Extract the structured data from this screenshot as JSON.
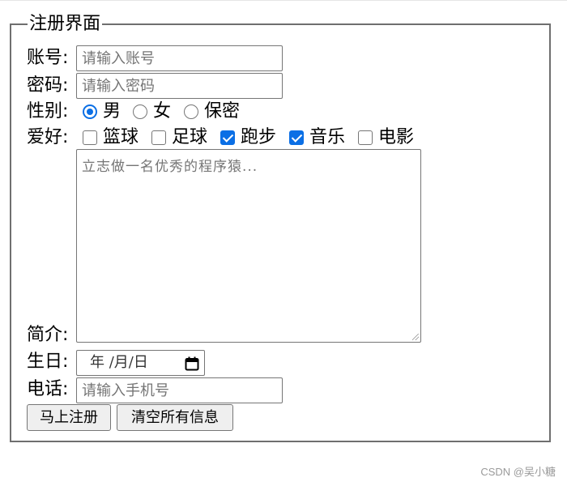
{
  "form": {
    "legend": "注册界面",
    "account": {
      "label": "账号:",
      "placeholder": "请输入账号",
      "value": ""
    },
    "password": {
      "label": "密码:",
      "placeholder": "请输入密码",
      "value": ""
    },
    "gender": {
      "label": "性别:",
      "options": [
        {
          "label": "男",
          "checked": true
        },
        {
          "label": "女",
          "checked": false
        },
        {
          "label": "保密",
          "checked": false
        }
      ]
    },
    "hobbies": {
      "label": "爱好:",
      "options": [
        {
          "label": "篮球",
          "checked": false
        },
        {
          "label": "足球",
          "checked": false
        },
        {
          "label": "跑步",
          "checked": true
        },
        {
          "label": "音乐",
          "checked": true
        },
        {
          "label": "电影",
          "checked": false
        }
      ]
    },
    "intro": {
      "label": "简介:",
      "placeholder": "立志做一名优秀的程序猿..."
    },
    "birthday": {
      "label": "生日:",
      "display": "年 /月/日",
      "icon": "calendar-icon"
    },
    "phone": {
      "label": "电话:",
      "placeholder": "请输入手机号",
      "value": ""
    },
    "buttons": {
      "submit": "马上注册",
      "reset": "清空所有信息"
    }
  },
  "watermark": "CSDN @吴小糖",
  "colors": {
    "accent": "#0b6fe5",
    "border": "#767676",
    "fieldset_border": "#6f6f6f"
  }
}
